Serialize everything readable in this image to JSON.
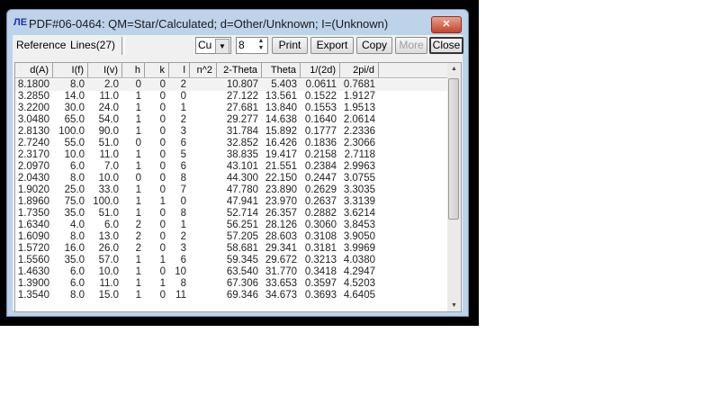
{
  "window": {
    "title": "PDF#06-0464: QM=Star/Calculated; d=Other/Unknown; I=(Unknown)",
    "app_icon": "pdf-logo-icon",
    "close_glyph": "✕"
  },
  "tabs": [
    {
      "label": "Reference"
    },
    {
      "label": "Lines(27)"
    }
  ],
  "toolbar": {
    "radiation": "Cu",
    "decimals": "8",
    "print": "Print",
    "export": "Export",
    "copy": "Copy",
    "more": "More",
    "close": "Close"
  },
  "table": {
    "columns": [
      "d(A)",
      "I(f)",
      "I(v)",
      "h",
      "k",
      "l",
      "n^2",
      "2-Theta",
      "Theta",
      "1/(2d)",
      "2pi/d"
    ],
    "rows": [
      [
        "8.1800",
        "8.0",
        "2.0",
        "0",
        "0",
        "2",
        "",
        "10.807",
        "5.403",
        "0.0611",
        "0.7681"
      ],
      [
        "3.2850",
        "14.0",
        "11.0",
        "1",
        "0",
        "0",
        "",
        "27.122",
        "13.561",
        "0.1522",
        "1.9127"
      ],
      [
        "3.2200",
        "30.0",
        "24.0",
        "1",
        "0",
        "1",
        "",
        "27.681",
        "13.840",
        "0.1553",
        "1.9513"
      ],
      [
        "3.0480",
        "65.0",
        "54.0",
        "1",
        "0",
        "2",
        "",
        "29.277",
        "14.638",
        "0.1640",
        "2.0614"
      ],
      [
        "2.8130",
        "100.0",
        "90.0",
        "1",
        "0",
        "3",
        "",
        "31.784",
        "15.892",
        "0.1777",
        "2.2336"
      ],
      [
        "2.7240",
        "55.0",
        "51.0",
        "0",
        "0",
        "6",
        "",
        "32.852",
        "16.426",
        "0.1836",
        "2.3066"
      ],
      [
        "2.3170",
        "10.0",
        "11.0",
        "1",
        "0",
        "5",
        "",
        "38.835",
        "19.417",
        "0.2158",
        "2.7118"
      ],
      [
        "2.0970",
        "6.0",
        "7.0",
        "1",
        "0",
        "6",
        "",
        "43.101",
        "21.551",
        "0.2384",
        "2.9963"
      ],
      [
        "2.0430",
        "8.0",
        "10.0",
        "0",
        "0",
        "8",
        "",
        "44.300",
        "22.150",
        "0.2447",
        "3.0755"
      ],
      [
        "1.9020",
        "25.0",
        "33.0",
        "1",
        "0",
        "7",
        "",
        "47.780",
        "23.890",
        "0.2629",
        "3.3035"
      ],
      [
        "1.8960",
        "75.0",
        "100.0",
        "1",
        "1",
        "0",
        "",
        "47.941",
        "23.970",
        "0.2637",
        "3.3139"
      ],
      [
        "1.7350",
        "35.0",
        "51.0",
        "1",
        "0",
        "8",
        "",
        "52.714",
        "26.357",
        "0.2882",
        "3.6214"
      ],
      [
        "1.6340",
        "4.0",
        "6.0",
        "2",
        "0",
        "1",
        "",
        "56.251",
        "28.126",
        "0.3060",
        "3.8453"
      ],
      [
        "1.6090",
        "8.0",
        "13.0",
        "2",
        "0",
        "2",
        "",
        "57.205",
        "28.603",
        "0.3108",
        "3.9050"
      ],
      [
        "1.5720",
        "16.0",
        "26.0",
        "2",
        "0",
        "3",
        "",
        "58.681",
        "29.341",
        "0.3181",
        "3.9969"
      ],
      [
        "1.5560",
        "35.0",
        "57.0",
        "1",
        "1",
        "6",
        "",
        "59.345",
        "29.672",
        "0.3213",
        "4.0380"
      ],
      [
        "1.4630",
        "6.0",
        "10.0",
        "1",
        "0",
        "10",
        "",
        "63.540",
        "31.770",
        "0.3418",
        "4.2947"
      ],
      [
        "1.3900",
        "6.0",
        "11.0",
        "1",
        "1",
        "8",
        "",
        "67.306",
        "33.653",
        "0.3597",
        "4.5203"
      ],
      [
        "1.3540",
        "8.0",
        "15.0",
        "1",
        "0",
        "11",
        "",
        "69.346",
        "34.673",
        "0.3693",
        "4.6405"
      ]
    ]
  }
}
